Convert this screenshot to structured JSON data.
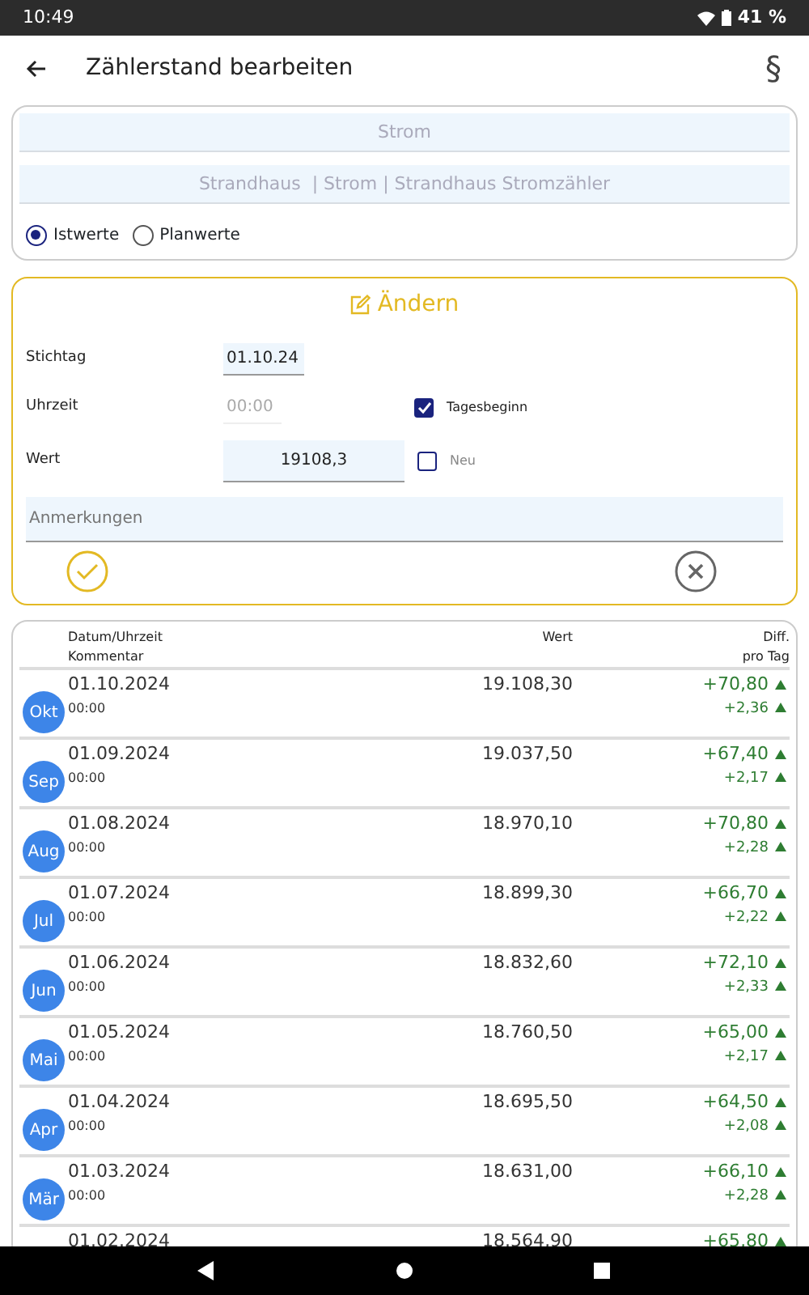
{
  "status_bar": {
    "time": "10:49",
    "battery": "41 %"
  },
  "app_bar": {
    "title": "Zählerstand bearbeiten",
    "action": "§"
  },
  "meter": {
    "category": "Strom",
    "path": "Strandhaus  | Strom | Strandhaus Stromzähler",
    "modes": [
      {
        "label": "Istwerte",
        "selected": true
      },
      {
        "label": "Planwerte",
        "selected": false
      }
    ]
  },
  "edit": {
    "title": "Ändern",
    "fields": [
      {
        "label": "Stichtag",
        "value": "01.10.24"
      },
      {
        "label": "Uhrzeit",
        "value": "00:00"
      },
      {
        "label": "Wert",
        "value": "19108,3"
      }
    ],
    "checkboxes": [
      {
        "label": "Tagesbeginn",
        "checked": true
      },
      {
        "label": "Neu",
        "checked": false
      }
    ],
    "notes": {
      "placeholder": "Anmerkungen"
    }
  },
  "table": {
    "columns": [
      [
        "Datum/Uhrzeit",
        "Kommentar"
      ],
      [
        "Wert"
      ],
      [
        "Diff.",
        "pro Tag"
      ]
    ],
    "rows": [
      {
        "month": "Okt",
        "date": "01.10.2024",
        "time": "00:00",
        "value": "19.108,30",
        "diff": "+70,80",
        "per_day": "+2,36"
      },
      {
        "month": "Sep",
        "date": "01.09.2024",
        "time": "00:00",
        "value": "19.037,50",
        "diff": "+67,40",
        "per_day": "+2,17"
      },
      {
        "month": "Aug",
        "date": "01.08.2024",
        "time": "00:00",
        "value": "18.970,10",
        "diff": "+70,80",
        "per_day": "+2,28"
      },
      {
        "month": "Jul",
        "date": "01.07.2024",
        "time": "00:00",
        "value": "18.899,30",
        "diff": "+66,70",
        "per_day": "+2,22"
      },
      {
        "month": "Jun",
        "date": "01.06.2024",
        "time": "00:00",
        "value": "18.832,60",
        "diff": "+72,10",
        "per_day": "+2,33"
      },
      {
        "month": "Mai",
        "date": "01.05.2024",
        "time": "00:00",
        "value": "18.760,50",
        "diff": "+65,00",
        "per_day": "+2,17"
      },
      {
        "month": "Apr",
        "date": "01.04.2024",
        "time": "00:00",
        "value": "18.695,50",
        "diff": "+64,50",
        "per_day": "+2,08"
      },
      {
        "month": "Mär",
        "date": "01.03.2024",
        "time": "00:00",
        "value": "18.631,00",
        "diff": "+66,10",
        "per_day": "+2,28"
      },
      {
        "date": "01.02.2024",
        "value": "18.564,90",
        "diff": "+65,80"
      }
    ]
  }
}
